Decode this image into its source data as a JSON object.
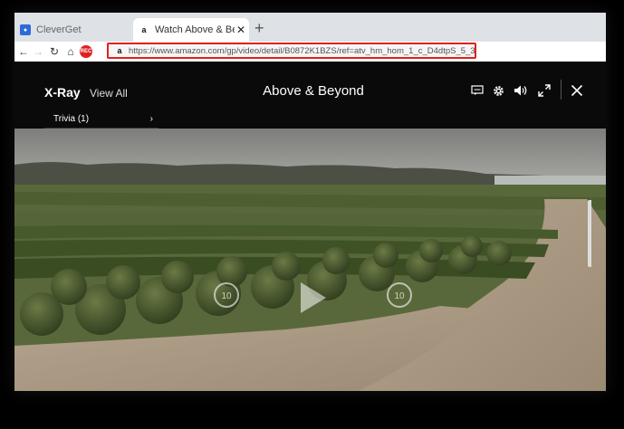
{
  "browser": {
    "tabs": [
      {
        "label": "CleverGet",
        "favicon": "cleverget-icon"
      },
      {
        "label": "Watch Above & Beyond",
        "favicon": "amazon-icon",
        "active": true
      }
    ],
    "rec_label": "REC",
    "url": "https://www.amazon.com/gp/video/detail/B0872K1BZS/ref=atv_hm_hom_1_c_D4dtpS_5_3"
  },
  "player": {
    "xray_label": "X-Ray",
    "view_all_label": "View All",
    "trivia_label": "Trivia (1)",
    "title": "Above & Beyond",
    "rewind_label": "10",
    "forward_label": "10",
    "controls": [
      "subtitles-icon",
      "gear-icon",
      "volume-icon",
      "fullscreen-icon",
      "close-icon"
    ]
  },
  "colors": {
    "highlight_box": "#e0201c",
    "player_bg": "#0a0a0a",
    "tabbar_bg": "#dee1e6"
  }
}
